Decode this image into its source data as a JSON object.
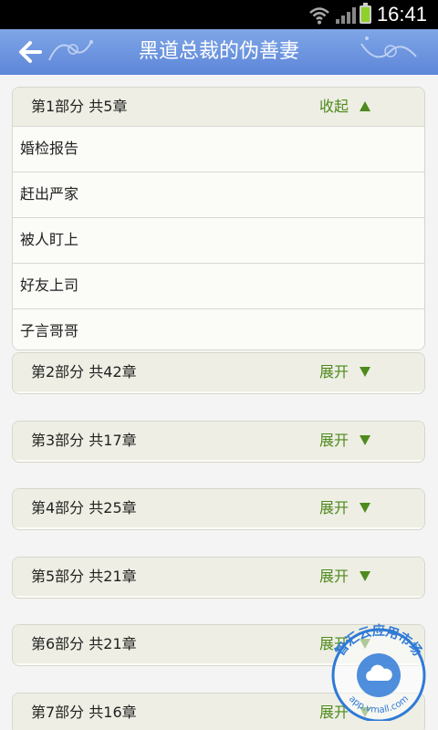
{
  "status_bar": {
    "time": "16:41"
  },
  "header": {
    "title": "黑道总裁的伪善妻"
  },
  "parts": [
    {
      "label": "第1部分  共5章",
      "toggle": "收起",
      "expanded": true,
      "chapters": [
        "婚检报告",
        "赶出严家",
        "被人盯上",
        "好友上司",
        "子言哥哥"
      ]
    },
    {
      "label": "第2部分  共42章",
      "toggle": "展开",
      "expanded": false
    },
    {
      "label": "第3部分  共17章",
      "toggle": "展开",
      "expanded": false
    },
    {
      "label": "第4部分  共25章",
      "toggle": "展开",
      "expanded": false
    },
    {
      "label": "第5部分  共21章",
      "toggle": "展开",
      "expanded": false
    },
    {
      "label": "第6部分  共21章",
      "toggle": "展开",
      "expanded": false
    },
    {
      "label": "第7部分  共16章",
      "toggle": "展开",
      "expanded": false
    }
  ],
  "watermark": {
    "text": "智汇云应用市场",
    "url": "app.vmall.com"
  },
  "colors": {
    "title_bar": "#6b93dd",
    "toggle_text": "#4e8a1c",
    "group_header_bg": "#eeeee4"
  }
}
